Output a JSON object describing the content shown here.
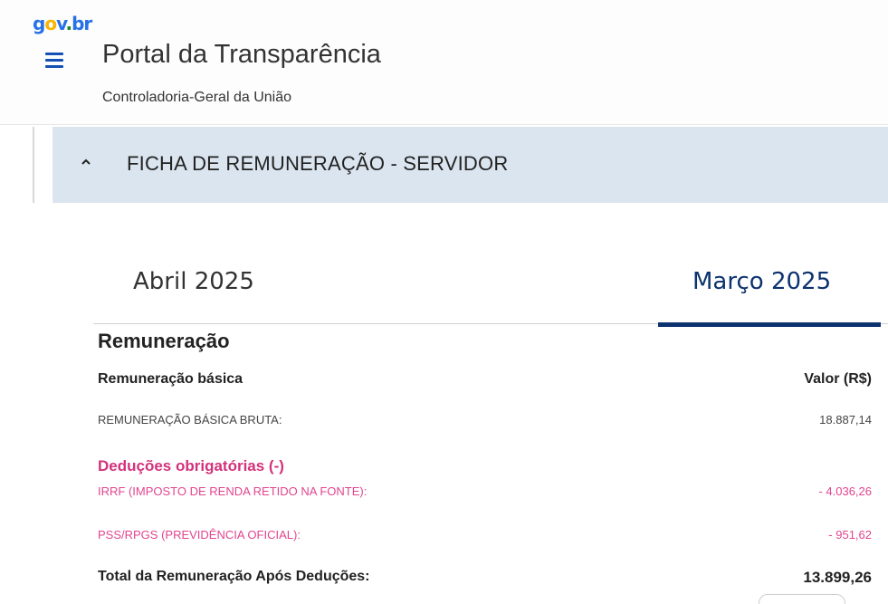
{
  "header": {
    "logo": {
      "g": "g",
      "o": "o",
      "v": "v",
      "dot": ".",
      "br": "br"
    },
    "title": "Portal da Transparência",
    "subtitle": "Controladoria-Geral da União"
  },
  "section": {
    "title": "FICHA DE REMUNERAÇÃO - SERVIDOR",
    "expanded": true
  },
  "tabs": [
    {
      "label": "Abril 2025",
      "active": false
    },
    {
      "label": "Março 2025",
      "active": true
    }
  ],
  "remuneracao": {
    "heading": "Remuneração",
    "basica_label": "Remuneração básica",
    "valor_header": "Valor (R$)",
    "bruta_label": "REMUNERAÇÃO BÁSICA BRUTA:",
    "bruta_value": "18.887,14"
  },
  "deducoes": {
    "title": "Deduções obrigatórias (-)",
    "items": [
      {
        "label": "IRRF (IMPOSTO DE RENDA RETIDO NA FONTE):",
        "value": "- 4.036,26"
      },
      {
        "label": "PSS/RPGS (PREVIDÊNCIA OFICIAL):",
        "value": "- 951,62"
      }
    ]
  },
  "total": {
    "label": "Total da Remuneração Após Deduções:",
    "value": "13.899,26"
  },
  "colors": {
    "brand_blue": "#1351b4",
    "active_tab": "#0c326f",
    "section_bg": "#dbe5ef",
    "deduction_pink": "#d3327c"
  },
  "icons": {
    "menu": "hamburger-icon",
    "section_toggle": "chevron-up-icon"
  }
}
